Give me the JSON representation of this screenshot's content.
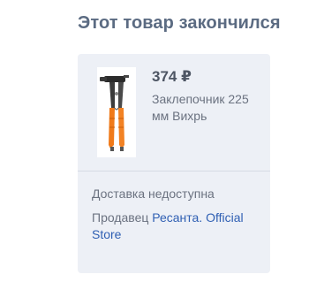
{
  "header": {
    "title": "Этот товар закончился"
  },
  "product": {
    "price": "374 ₽",
    "name": "Заклепочник 225 мм Вихрь",
    "image_icon": "rivet-tool-image"
  },
  "delivery": {
    "status": "Доставка недоступна"
  },
  "seller": {
    "label": "Продавец",
    "name": "Ресанта. Official Store"
  },
  "colors": {
    "card_bg": "#edf0f6",
    "title": "#5b6b82",
    "link": "#2f5fb3",
    "handle_orange": "#f07a1a"
  }
}
